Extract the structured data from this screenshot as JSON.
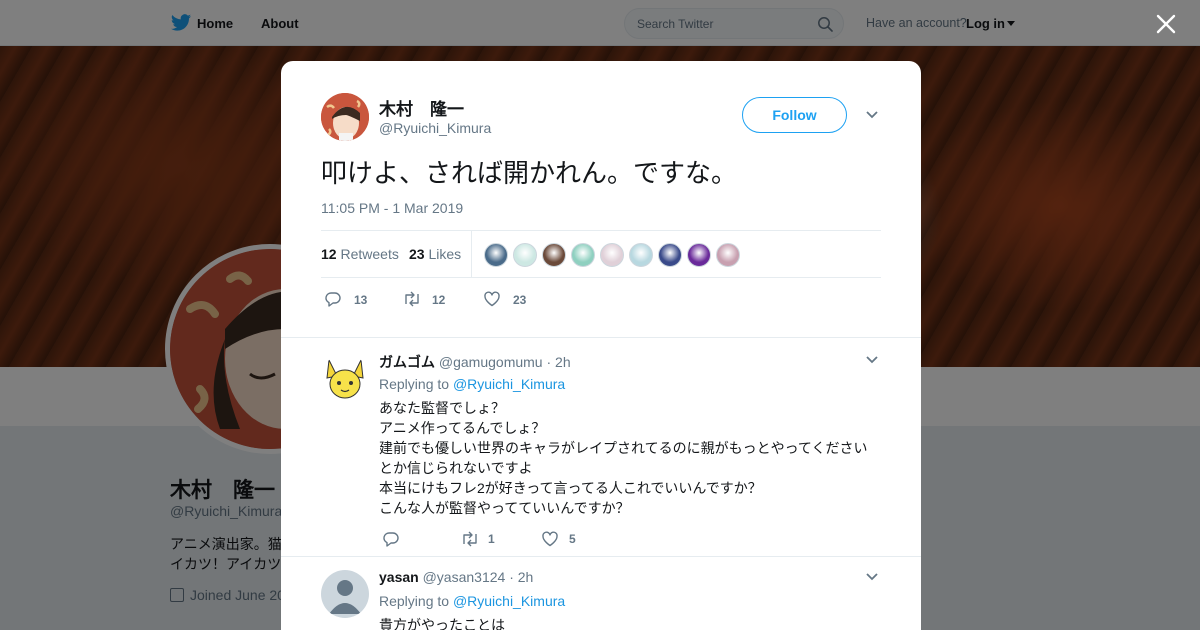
{
  "nav": {
    "home_label": "Home",
    "about_label": "About",
    "search_placeholder": "Search Twitter",
    "have_account": "Have an account?",
    "login_label": "Log in"
  },
  "profile": {
    "name": "木村　隆一",
    "handle": "@Ryuichi_Kimura",
    "bio_visible": "アニメ演出家。猫\nイカツ！アイカツ",
    "joined_visible": "Joined June 20"
  },
  "tweet": {
    "author_name": "木村　隆一",
    "author_handle": "@Ryuichi_Kimura",
    "follow_label": "Follow",
    "text": "叩けよ、されば開かれん。ですな。",
    "timestamp": "11:05 PM - 1 Mar 2019",
    "retweets_count": "12",
    "retweets_label": "Retweets",
    "likes_count": "23",
    "likes_label": "Likes",
    "actions": {
      "reply_count": "13",
      "retweet_count": "12",
      "like_count": "23"
    },
    "liker_colors": [
      "#4a6b8a",
      "#cde8e3",
      "#6b4a3a",
      "#8fd0c0",
      "#e0d0d8",
      "#b8d8e0",
      "#3a4a8a",
      "#6a2a9a",
      "#c8a0b0"
    ]
  },
  "replies": [
    {
      "name": "ガムゴム",
      "handle": "@gamugomumu",
      "time": "· 2h",
      "replying_prefix": "Replying to",
      "replying_to": "@Ryuichi_Kimura",
      "body": "あなた監督でしょ？\nアニメ作ってるんでしょ？\n建前でも優しい世界のキャラがレイプされてるのに親がもっとやってください\nとか信じられないですよ\n本当にけもフレ2が好きって言ってる人これでいいんですか？\nこんな人が監督やってていいんですか？",
      "retweet_count": "1",
      "like_count": "5",
      "avatar_color": "#f7e24a"
    },
    {
      "name": "yasan",
      "handle": "@yasan3124",
      "time": "· 2h",
      "replying_prefix": "Replying to",
      "replying_to": "@Ryuichi_Kimura",
      "body": "貴方がやったことは",
      "avatar_color": "#ccd6dd"
    }
  ]
}
